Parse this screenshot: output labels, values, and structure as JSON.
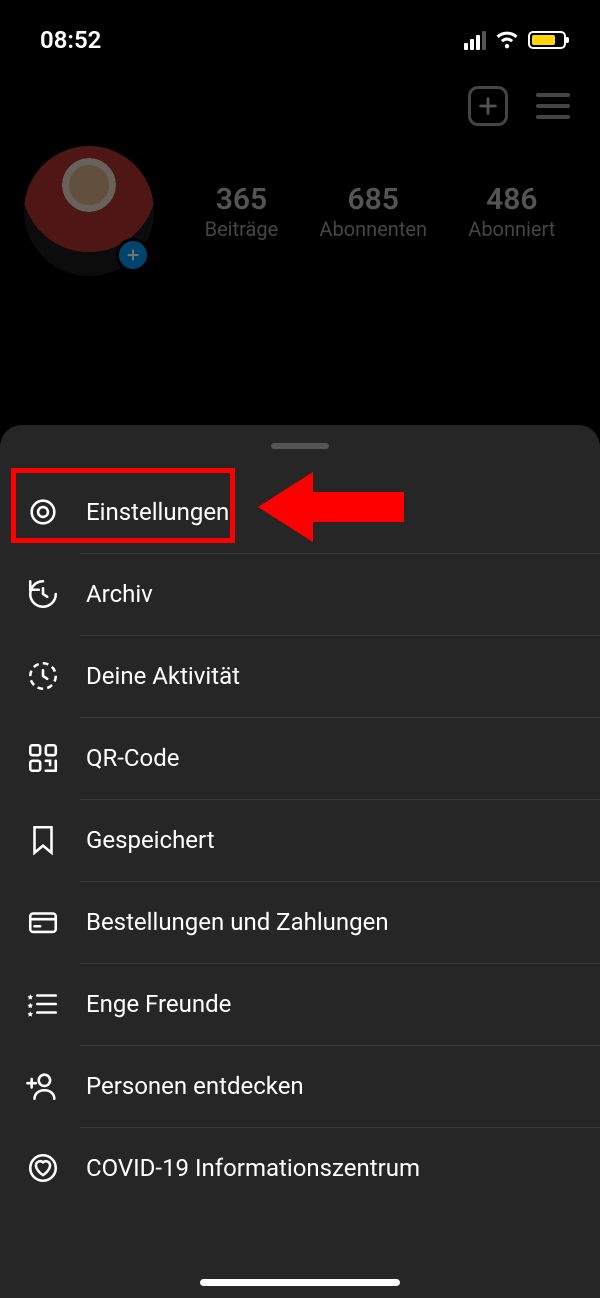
{
  "status": {
    "time": "08:52"
  },
  "stats": {
    "posts": {
      "value": "365",
      "label": "Beiträge"
    },
    "followers": {
      "value": "685",
      "label": "Abonnenten"
    },
    "following": {
      "value": "486",
      "label": "Abonniert"
    }
  },
  "menu": {
    "settings": "Einstellungen",
    "archive": "Archiv",
    "activity": "Deine Aktivität",
    "qr": "QR-Code",
    "saved": "Gespeichert",
    "orders": "Bestellungen und Zahlungen",
    "closefriends": "Enge Freunde",
    "discover": "Personen entdecken",
    "covid": "COVID-19 Informationszentrum"
  }
}
